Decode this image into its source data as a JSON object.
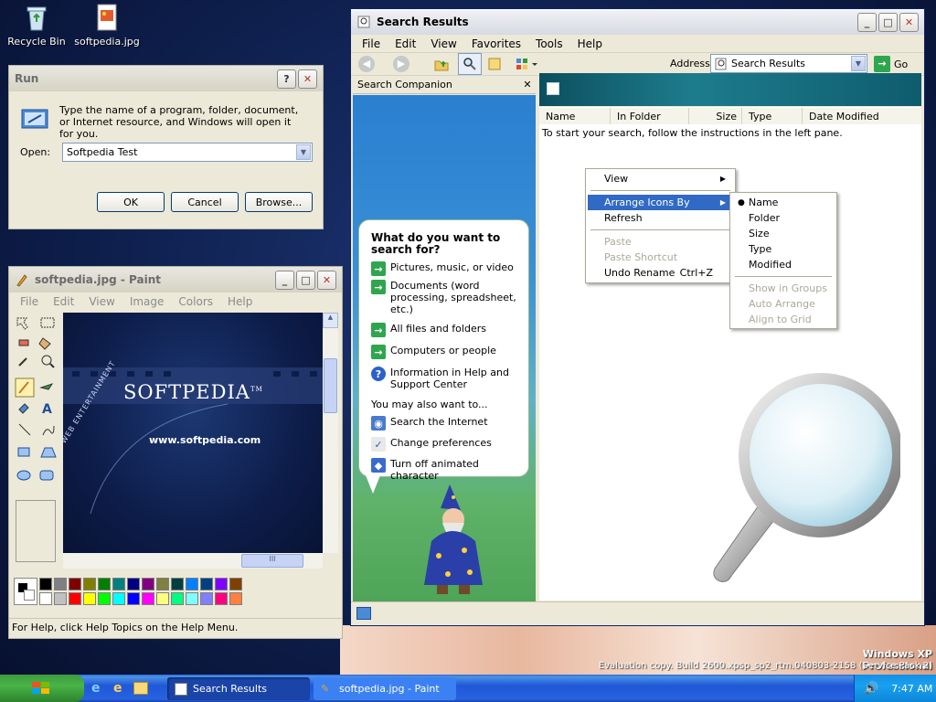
{
  "desktop": {
    "icons": [
      {
        "label": "Recycle Bin"
      },
      {
        "label": "softpedia.jpg"
      }
    ]
  },
  "run_dialog": {
    "title": "Run",
    "description": "Type the name of a program, folder, document, or Internet resource, and Windows will open it for you.",
    "open_label": "Open:",
    "open_value": "Softpedia Test",
    "ok_label": "OK",
    "cancel_label": "Cancel",
    "browse_label": "Browse..."
  },
  "paint": {
    "title": "softpedia.jpg - Paint",
    "menu": [
      "File",
      "Edit",
      "View",
      "Image",
      "Colors",
      "Help"
    ],
    "canvas_logo": "SOFTPEDIA",
    "canvas_tm": "TM",
    "canvas_url": "www.softpedia.com",
    "canvas_side": "WEB ENTERTAINMENT",
    "status": "For Help, click Help Topics on the Help Menu.",
    "palette_top": [
      "#000000",
      "#808080",
      "#800000",
      "#808000",
      "#008000",
      "#008080",
      "#000080",
      "#800080",
      "#808040",
      "#004040",
      "#0080ff",
      "#004080",
      "#8000ff",
      "#804000"
    ],
    "palette_bottom": [
      "#ffffff",
      "#c0c0c0",
      "#ff0000",
      "#ffff00",
      "#00ff00",
      "#00ffff",
      "#0000ff",
      "#ff00ff",
      "#ffff80",
      "#00ff80",
      "#80ffff",
      "#8080ff",
      "#ff0080",
      "#ff8040"
    ]
  },
  "search_window": {
    "title": "Search Results",
    "menu": [
      "File",
      "Edit",
      "View",
      "Favorites",
      "Tools",
      "Help"
    ],
    "address_label": "Address",
    "address_value": "Search Results",
    "go_label": "Go",
    "companion_title": "Search Companion",
    "close_glyph": "✕",
    "bubble": {
      "heading": "What do you want to search for?",
      "options": [
        "Pictures, music, or video",
        "Documents (word processing, spreadsheet, etc.)",
        "All files and folders",
        "Computers or people",
        "Information in Help and Support Center"
      ],
      "also_label": "You may also want to...",
      "also_options": [
        "Search the Internet",
        "Change preferences",
        "Turn off animated character"
      ]
    },
    "columns": [
      "Name",
      "In Folder",
      "Size",
      "Type",
      "Date Modified"
    ],
    "empty_message": "To start your search, follow the instructions in the left pane."
  },
  "context_menu": {
    "items": [
      {
        "label": "View",
        "submenu": true,
        "disabled": false
      },
      {
        "label": "Arrange Icons By",
        "submenu": true,
        "disabled": false,
        "highlight": true
      },
      {
        "label": "Refresh",
        "disabled": false
      },
      {
        "label": "Paste",
        "disabled": true
      },
      {
        "label": "Paste Shortcut",
        "disabled": true
      },
      {
        "label": "Undo Rename",
        "shortcut": "Ctrl+Z",
        "disabled": false
      }
    ]
  },
  "arrange_submenu": {
    "items": [
      {
        "label": "Name",
        "checked": true,
        "disabled": false
      },
      {
        "label": "Folder",
        "disabled": false
      },
      {
        "label": "Size",
        "disabled": false
      },
      {
        "label": "Type",
        "disabled": false
      },
      {
        "label": "Modified",
        "disabled": false
      },
      {
        "label": "Show in Groups",
        "disabled": true
      },
      {
        "label": "Auto Arrange",
        "disabled": true
      },
      {
        "label": "Align to Grid",
        "disabled": true
      }
    ]
  },
  "watermark": {
    "os": "Windows XP Professional",
    "eval": "Evaluation copy. Build 2600.xpsp_sp2_rtm.040803-2158 (Service Pack 2)"
  },
  "taskbar": {
    "items": [
      {
        "label": "Search Results"
      },
      {
        "label": "softpedia.jpg - Paint"
      }
    ],
    "clock": "7:47 AM"
  },
  "colors": {
    "xp_blue": "#0a246a",
    "highlight": "#316ac5",
    "companion_green": "#4eaa5f"
  }
}
